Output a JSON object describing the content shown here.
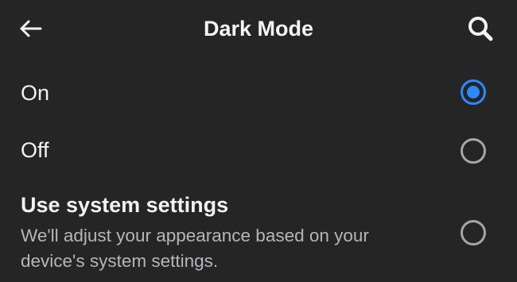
{
  "header": {
    "title": "Dark Mode",
    "back_icon": "back-arrow-icon",
    "search_icon": "search-icon"
  },
  "options": [
    {
      "label": "On",
      "selected": true
    },
    {
      "label": "Off",
      "selected": false
    },
    {
      "label": "Use system settings",
      "description": "We'll adjust your appearance based on your device's system settings.",
      "selected": false
    }
  ],
  "colors": {
    "background": "#252526",
    "accent": "#2d88ff",
    "text_primary": "#f2f2f2",
    "text_secondary": "#b6b6b8",
    "radio_border": "#a6a6aa"
  }
}
